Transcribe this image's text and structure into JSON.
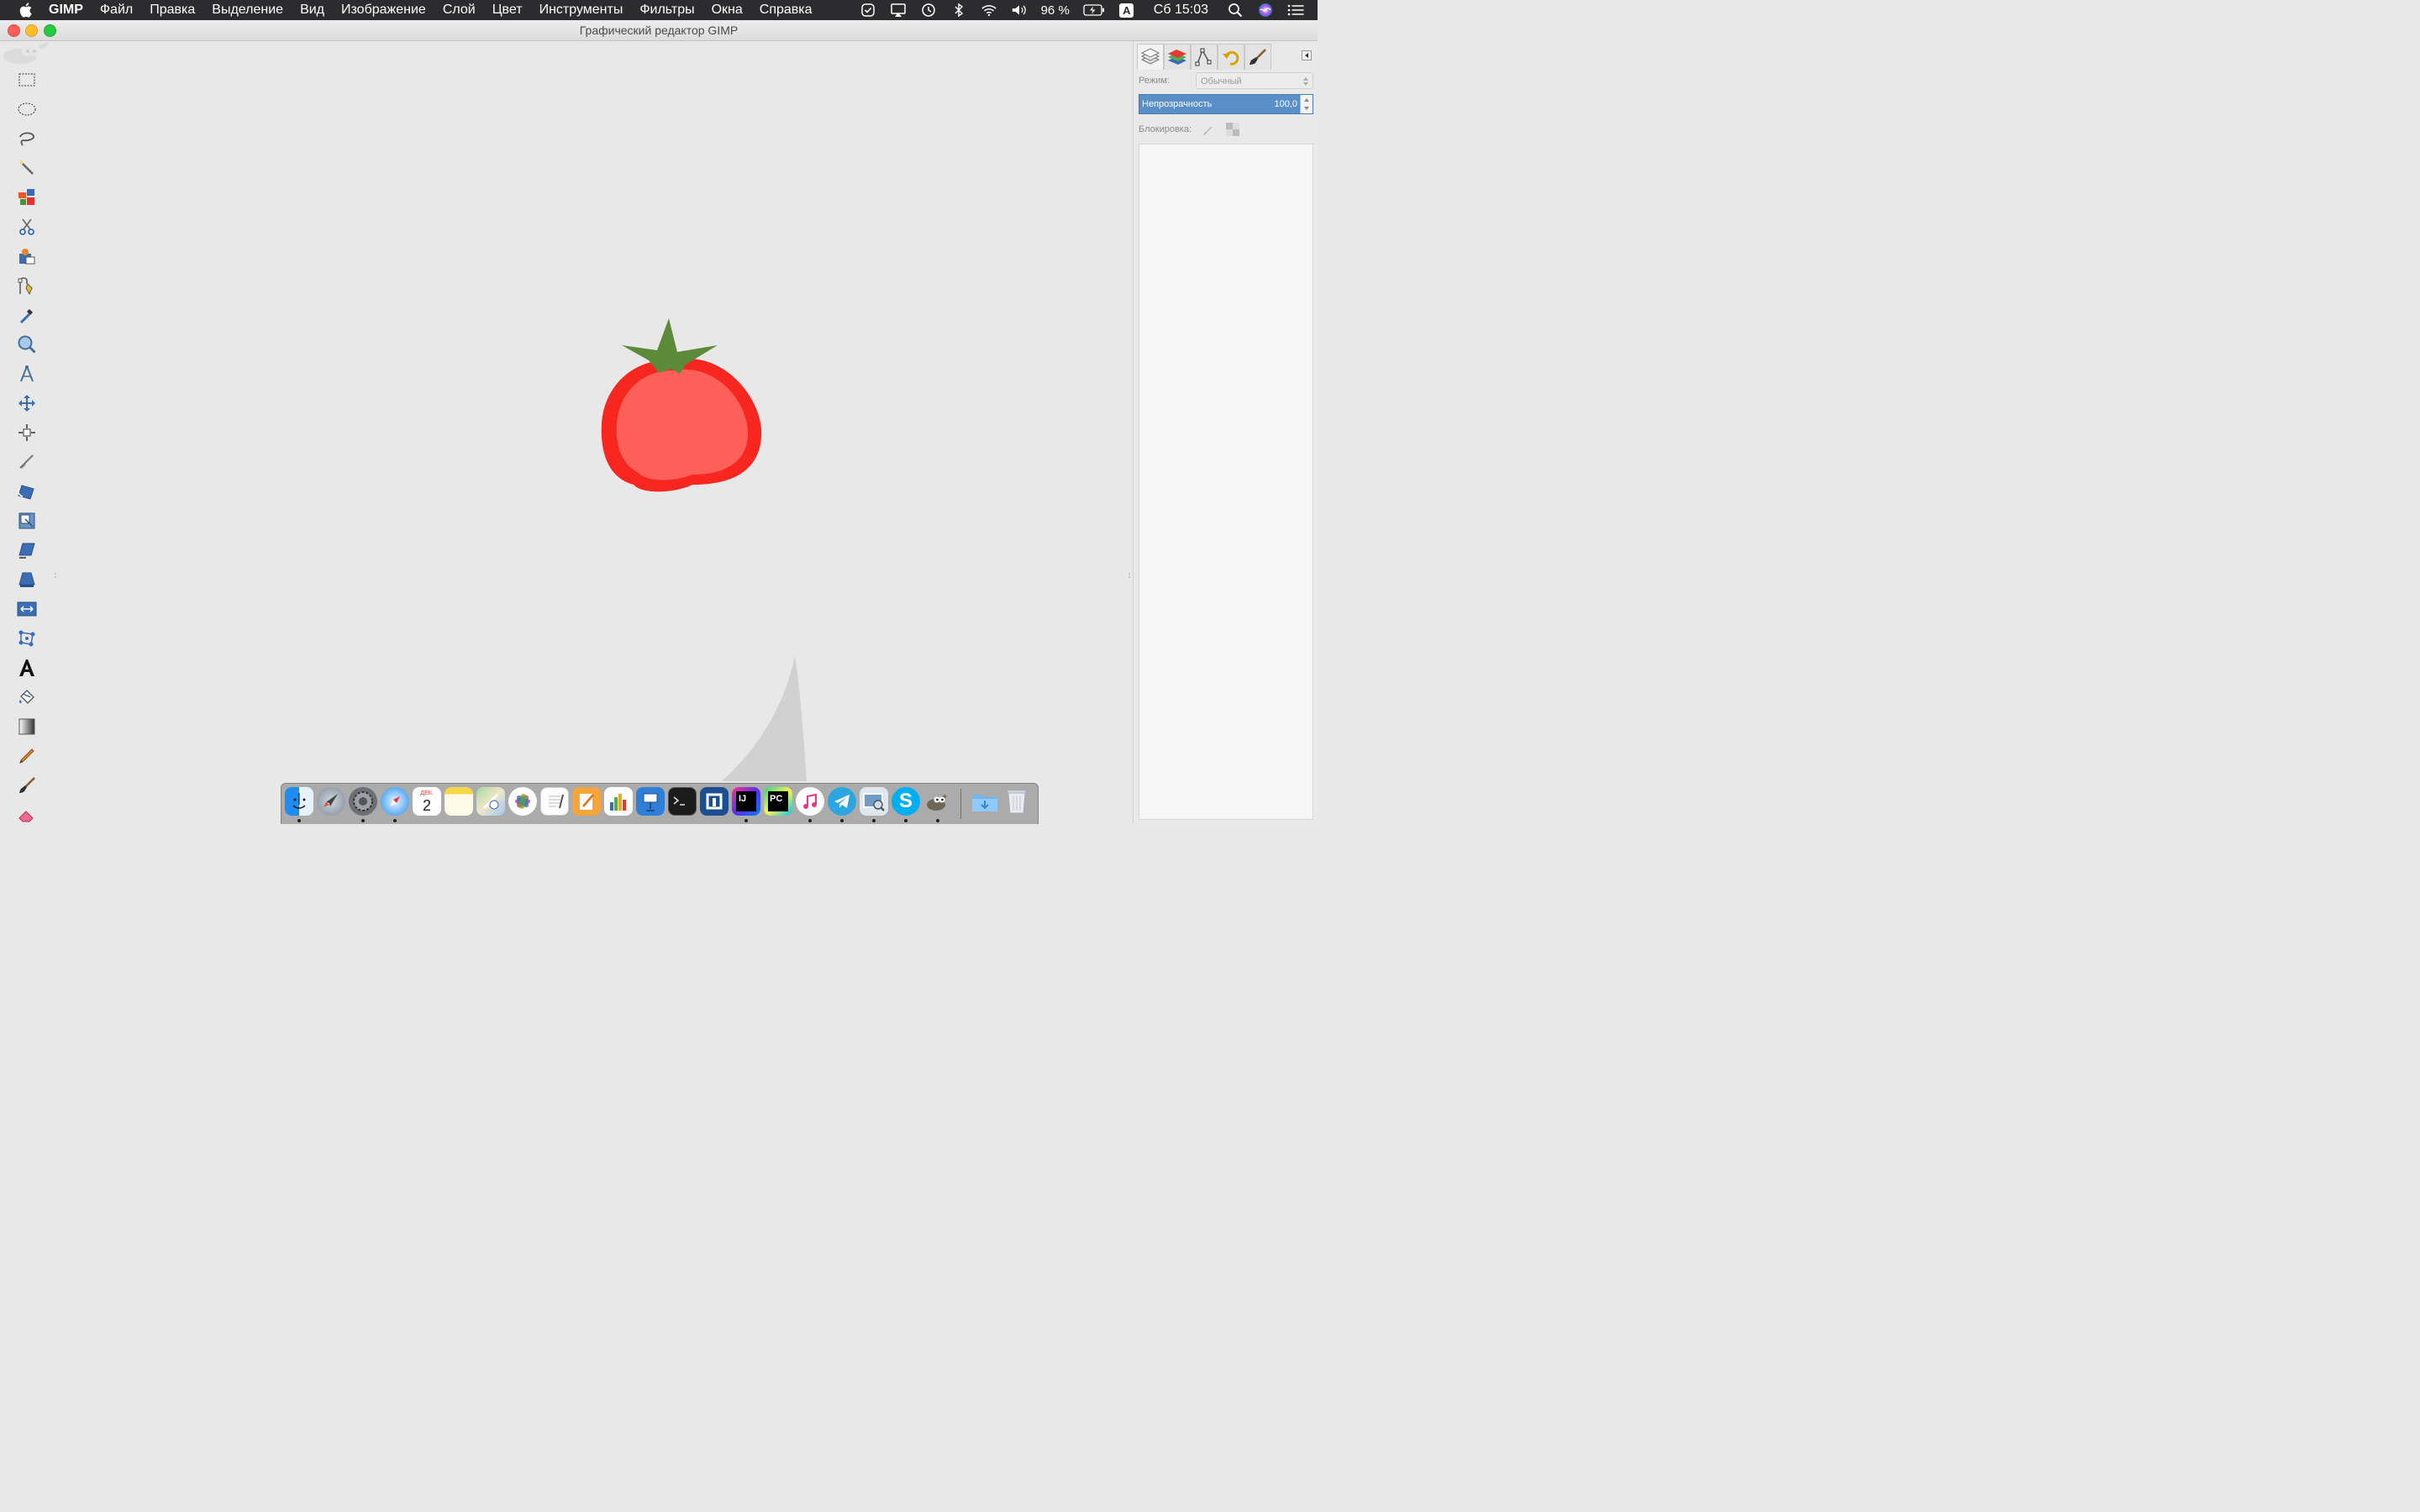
{
  "menubar": {
    "app_name": "GIMP",
    "items": [
      "Файл",
      "Правка",
      "Выделение",
      "Вид",
      "Изображение",
      "Слой",
      "Цвет",
      "Инструменты",
      "Фильтры",
      "Окна",
      "Справка"
    ],
    "battery": "96 %",
    "input_source": "A",
    "clock": "Сб 15:03"
  },
  "window": {
    "title": "Графический редактор GIMP"
  },
  "tools": [
    "rect-select",
    "ellipse-select",
    "free-select",
    "fuzzy-select",
    "select-by-color",
    "scissors-select",
    "foreground-select",
    "paths",
    "color-picker",
    "zoom",
    "measure",
    "move",
    "align",
    "crop",
    "rotate",
    "scale",
    "shear",
    "perspective",
    "flip",
    "cage-transform",
    "text",
    "bucket-fill",
    "gradient",
    "pencil",
    "paintbrush",
    "eraser"
  ],
  "layers_panel": {
    "mode_label": "Режим:",
    "mode_value": "Обычный",
    "opacity_label": "Непрозрачность",
    "opacity_value": "100,0",
    "lock_label": "Блокировка:"
  },
  "dock_tabs": [
    "layers-tab",
    "channels-tab",
    "paths-tab",
    "undo-history-tab",
    "brushes-tab"
  ],
  "dock_date": {
    "month": "ДЕК.",
    "day": "2"
  },
  "dock_apps": [
    "Finder",
    "Launchpad",
    "System Preferences",
    "Safari",
    "Calendar",
    "Notes",
    "Maps",
    "Photos",
    "TextEdit",
    "Pages",
    "Numbers",
    "Keynote",
    "Terminal",
    "Sourcetree",
    "IntelliJ IDEA",
    "PyCharm",
    "iTunes",
    "Telegram",
    "Preview",
    "Skype",
    "GIMP",
    "Downloads",
    "Trash"
  ]
}
